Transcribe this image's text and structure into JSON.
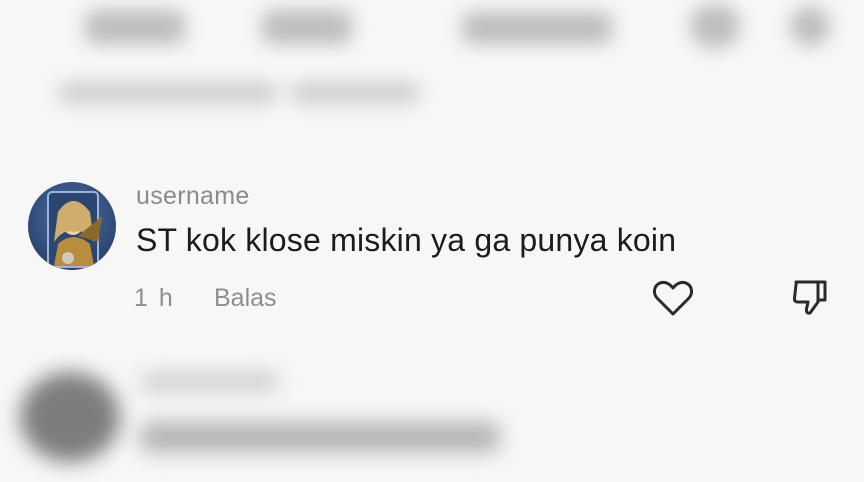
{
  "comment": {
    "username": "username",
    "text": "ST kok klose miskin ya ga punya koin",
    "time": "1 h",
    "reply_label": "Balas"
  },
  "icons": {
    "like": "heart-icon",
    "dislike": "thumbs-down-icon"
  },
  "colors": {
    "text_primary": "#1c1c1c",
    "text_secondary": "#8b8b8b",
    "background": "#f7f7f7"
  }
}
